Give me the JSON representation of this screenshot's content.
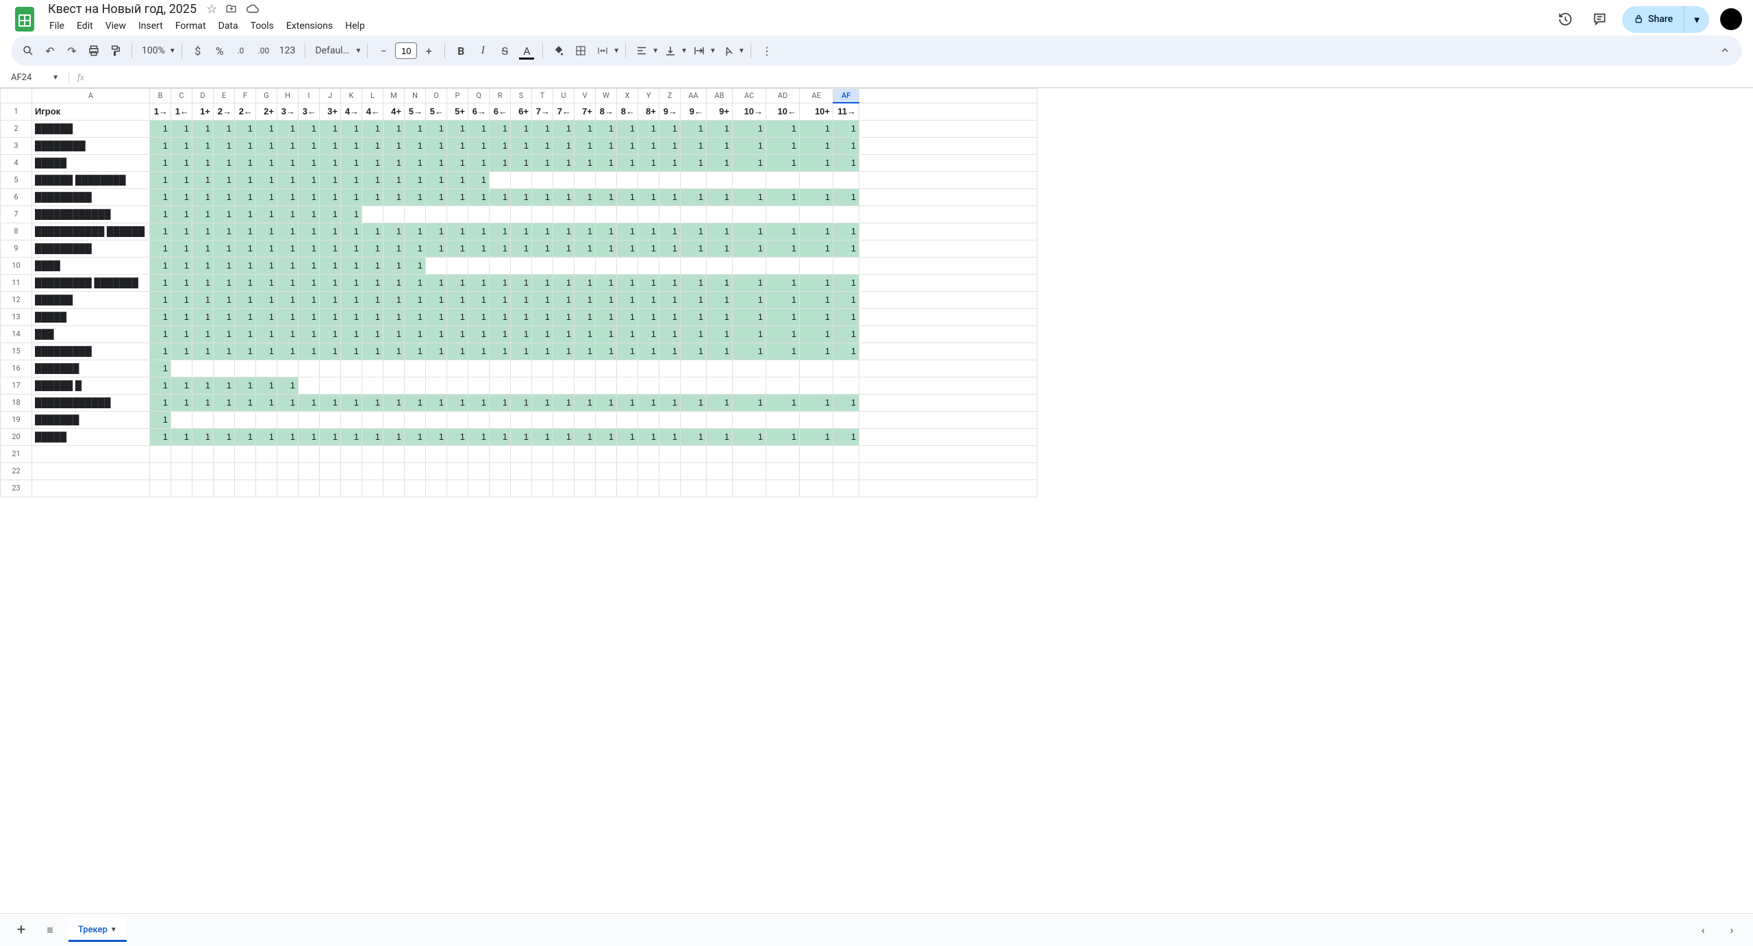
{
  "doc": {
    "title": "Квест на Новый год, 2025"
  },
  "menu": {
    "file": "File",
    "edit": "Edit",
    "view": "View",
    "insert": "Insert",
    "format": "Format",
    "data": "Data",
    "tools": "Tools",
    "extensions": "Extensions",
    "help": "Help"
  },
  "toolbar": {
    "zoom": "100%",
    "font": "Defaul…",
    "size": "10",
    "share": "Share"
  },
  "name_box": "AF24",
  "formula": "",
  "columns": [
    "A",
    "B",
    "C",
    "D",
    "E",
    "F",
    "G",
    "H",
    "I",
    "J",
    "K",
    "L",
    "M",
    "N",
    "O",
    "P",
    "Q",
    "R",
    "S",
    "T",
    "U",
    "V",
    "W",
    "X",
    "Y",
    "Z",
    "AA",
    "AB",
    "AC",
    "AD",
    "AE",
    "AF"
  ],
  "header_row": [
    "Игрок",
    "1→",
    "1←",
    "1+",
    "2→",
    "2←",
    "2+",
    "3→",
    "3←",
    "3+",
    "4→",
    "4←",
    "4+",
    "5→",
    "5←",
    "5+",
    "6→",
    "6←",
    "6+",
    "7→",
    "7←",
    "7+",
    "8→",
    "8←",
    "8+",
    "9→",
    "9←",
    "9+",
    "10→",
    "10←",
    "10+",
    "11→"
  ],
  "rows": [
    {
      "n": "██████",
      "c": 31
    },
    {
      "n": "████████",
      "c": 31
    },
    {
      "n": "█████",
      "c": 31
    },
    {
      "n": "██████ ████████",
      "c": 16
    },
    {
      "n": "█████████",
      "c": 31
    },
    {
      "n": "████████████",
      "c": 10
    },
    {
      "n": "███████████ ██████",
      "c": 31
    },
    {
      "n": "█████████",
      "c": 31
    },
    {
      "n": "████",
      "c": 13
    },
    {
      "n": "█████████ ███████",
      "c": 31
    },
    {
      "n": "██████",
      "c": 31
    },
    {
      "n": "█████",
      "c": 31
    },
    {
      "n": "███",
      "c": 31
    },
    {
      "n": "█████████",
      "c": 31
    },
    {
      "n": "███████",
      "c": 1
    },
    {
      "n": "██████ █",
      "c": 7
    },
    {
      "n": "████████████",
      "c": 31
    },
    {
      "n": "███████",
      "c": 1
    },
    {
      "n": "█████",
      "c": 31
    }
  ],
  "blank_rows": 3,
  "selected_col": "AF",
  "selected_row": 24,
  "sheet_tab": "Трекер"
}
